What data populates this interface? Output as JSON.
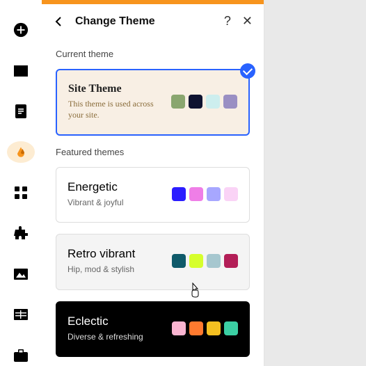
{
  "panel": {
    "title": "Change Theme",
    "help_glyph": "?",
    "close_glyph": "✕",
    "sections": {
      "current_label": "Current theme",
      "featured_label": "Featured themes"
    }
  },
  "themes": {
    "current": {
      "title": "Site Theme",
      "subtitle": "This theme is used across your site.",
      "swatches": [
        "#8aa66f",
        "#0e1330",
        "#cdeeee",
        "#9a8fc3"
      ]
    },
    "featured": [
      {
        "id": "energetic",
        "title": "Energetic",
        "subtitle": "Vibrant & joyful",
        "swatches": [
          "#2b1dff",
          "#ef7ee7",
          "#a7a7ff",
          "#fad3f6"
        ],
        "variant": "light"
      },
      {
        "id": "retro",
        "title": "Retro vibrant",
        "subtitle": "Hip, mod & stylish",
        "swatches": [
          "#0f5a6a",
          "#d6ff2c",
          "#a6c7cf",
          "#b31e57"
        ],
        "variant": "hover"
      },
      {
        "id": "eclectic",
        "title": "Eclectic",
        "subtitle": "Diverse & refreshing",
        "swatches": [
          "#f9b4d0",
          "#ff7a2f",
          "#f4c021",
          "#3bcfa3"
        ],
        "variant": "dark"
      }
    ]
  },
  "rail": {
    "items": [
      "add",
      "card",
      "page",
      "theme",
      "grid",
      "plugin",
      "image",
      "table",
      "briefcase"
    ]
  }
}
